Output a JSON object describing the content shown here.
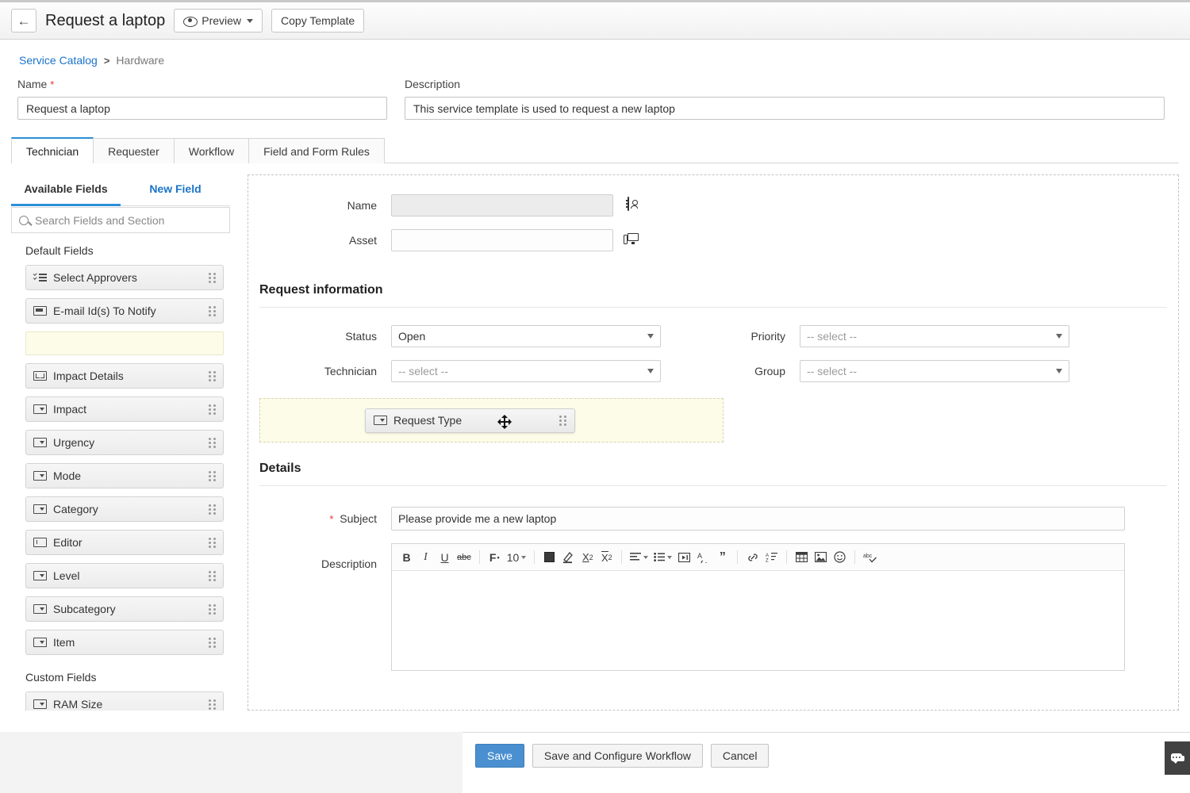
{
  "header": {
    "back_icon": "arrow-left-icon",
    "title": "Request a laptop",
    "preview_label": "Preview",
    "preview_icon": "eye-icon",
    "copy_template_label": "Copy Template"
  },
  "breadcrumb": {
    "root": "Service Catalog",
    "separator": ">",
    "current": "Hardware"
  },
  "top_fields": {
    "name_label": "Name",
    "name_required": "*",
    "name_value": "Request a laptop",
    "description_label": "Description",
    "description_value": "This service template is used to request a new laptop"
  },
  "tabs": [
    {
      "label": "Technician",
      "active": true
    },
    {
      "label": "Requester",
      "active": false
    },
    {
      "label": "Workflow",
      "active": false
    },
    {
      "label": "Field and Form Rules",
      "active": false
    }
  ],
  "left_panel": {
    "tab_available": "Available Fields",
    "tab_new_field": "New Field",
    "search_placeholder": "Search Fields and Section",
    "search_icon": "search-icon",
    "groups": [
      {
        "title": "Default Fields",
        "fields": [
          {
            "label": "Select Approvers",
            "type": "checklist"
          },
          {
            "label": "E-mail Id(s) To Notify",
            "type": "text"
          },
          {
            "label": "",
            "type": "placeholder-gap"
          },
          {
            "label": "Impact Details",
            "type": "textarea"
          },
          {
            "label": "Impact",
            "type": "select"
          },
          {
            "label": "Urgency",
            "type": "select"
          },
          {
            "label": "Mode",
            "type": "select"
          },
          {
            "label": "Category",
            "type": "select"
          },
          {
            "label": "Editor",
            "type": "editor"
          },
          {
            "label": "Level",
            "type": "select"
          },
          {
            "label": "Subcategory",
            "type": "select"
          },
          {
            "label": "Item",
            "type": "select"
          }
        ]
      },
      {
        "title": "Custom Fields",
        "fields": [
          {
            "label": "RAM Size",
            "type": "select"
          }
        ]
      }
    ]
  },
  "canvas": {
    "requester_rows": [
      {
        "label": "Name",
        "value": "",
        "disabled": true,
        "icon": "contact-card-icon"
      },
      {
        "label": "Asset",
        "value": "",
        "disabled": false,
        "icon": "asset-monitor-icon"
      }
    ],
    "request_information": {
      "section_title": "Request information",
      "status_label": "Status",
      "status_value": "Open",
      "priority_label": "Priority",
      "priority_value": "-- select --",
      "technician_label": "Technician",
      "technician_value": "-- select --",
      "group_label": "Group",
      "group_value": "-- select --"
    },
    "drop_zone": {
      "dragged_field_label": "Request Type",
      "dragged_field_type": "select",
      "cursor_icon": "move-cursor-icon"
    },
    "details": {
      "section_title": "Details",
      "subject_label": "Subject",
      "subject_required": "*",
      "subject_value": "Please provide me a new laptop",
      "description_label": "Description",
      "description_value": "",
      "toolbar": [
        {
          "name": "bold",
          "glyph": "B"
        },
        {
          "name": "italic",
          "glyph": "I"
        },
        {
          "name": "underline",
          "glyph": "U"
        },
        {
          "name": "strikethrough",
          "glyph": "abc"
        },
        {
          "name": "font-family",
          "glyph": "F"
        },
        {
          "name": "font-size",
          "glyph": "10"
        },
        {
          "name": "font-color",
          "glyph": ""
        },
        {
          "name": "highlight-color",
          "glyph": ""
        },
        {
          "name": "subscript",
          "glyph": "X₂"
        },
        {
          "name": "superscript",
          "glyph": "X²"
        },
        {
          "name": "align",
          "glyph": ""
        },
        {
          "name": "bullet-list",
          "glyph": ""
        },
        {
          "name": "indent",
          "glyph": ""
        },
        {
          "name": "clear-format",
          "glyph": ""
        },
        {
          "name": "blockquote",
          "glyph": "”"
        },
        {
          "name": "link",
          "glyph": ""
        },
        {
          "name": "sort-list",
          "glyph": ""
        },
        {
          "name": "table",
          "glyph": ""
        },
        {
          "name": "image",
          "glyph": ""
        },
        {
          "name": "emoji",
          "glyph": "☺"
        },
        {
          "name": "spellcheck",
          "glyph": "abc"
        }
      ]
    }
  },
  "footer": {
    "save_label": "Save",
    "save_configure_label": "Save and Configure Workflow",
    "cancel_label": "Cancel"
  },
  "chat": {
    "icon": "chat-bubbles-icon"
  },
  "colors": {
    "accent_blue": "#2a8fd8",
    "link_blue": "#1a73c9",
    "save_blue": "#4a90d1",
    "required_red": "#e33",
    "drop_zone_yellow": "#fdfce8"
  }
}
